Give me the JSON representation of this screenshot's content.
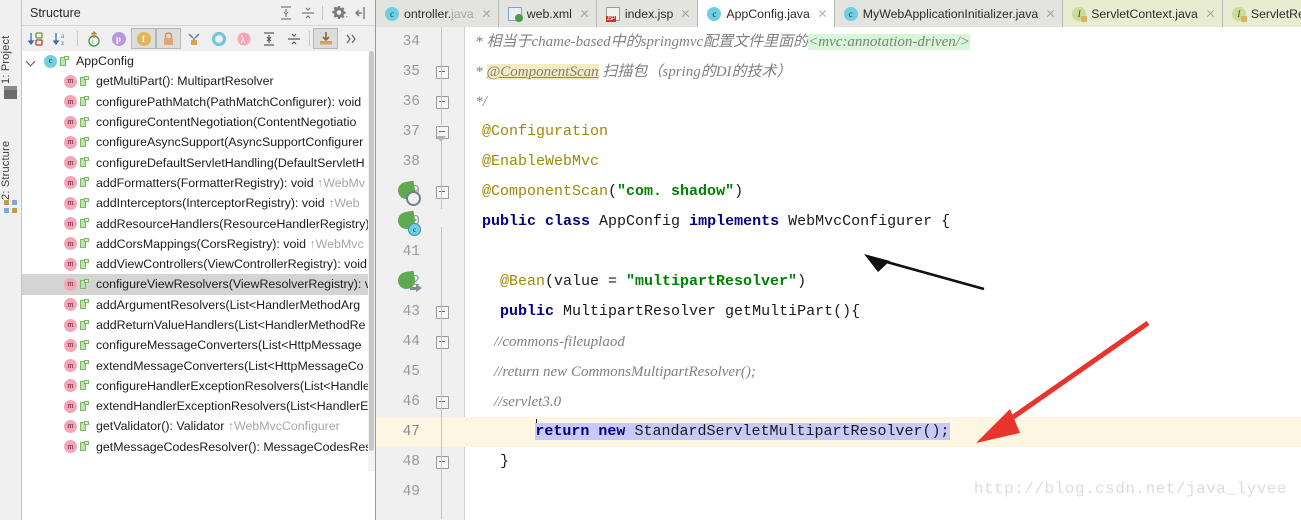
{
  "toolwindow_bar": {
    "tabs": [
      {
        "label": "1: Project",
        "icon": "project-icon"
      },
      {
        "label": "2: Structure",
        "icon": "structure-icon"
      }
    ]
  },
  "structure": {
    "title": "Structure",
    "header_icons": [
      "expand-all-icon",
      "collapse-all-icon",
      "settings-gear-icon",
      "hide-panel-icon"
    ],
    "toolbar_icons": [
      "sort-by-visibility-icon",
      "sort-alphabetically-icon",
      "show-inherited-icon",
      "show-properties-icon",
      "show-fields-icon",
      "show-non-public-icon",
      "show-anonymous-icon",
      "show-interfaces-icon",
      "show-lambdas-icon",
      "expand-all-icon",
      "collapse-all-icon",
      "autoscroll-to-source-icon",
      "overflow-icon"
    ],
    "root": {
      "label": "AppConfig",
      "badge": "c"
    },
    "members": [
      {
        "label": "getMultiPart(): MultipartResolver",
        "sup": "",
        "badge": "m"
      },
      {
        "label": "configurePathMatch(PathMatchConfigurer): void",
        "sup": "",
        "badge": "m"
      },
      {
        "label": "configureContentNegotiation(ContentNegotiatio",
        "sup": "",
        "badge": "m"
      },
      {
        "label": "configureAsyncSupport(AsyncSupportConfigurer",
        "sup": "",
        "badge": "m"
      },
      {
        "label": "configureDefaultServletHandling(DefaultServletH",
        "sup": "",
        "badge": "m"
      },
      {
        "label": "addFormatters(FormatterRegistry): void ",
        "sup": "↑WebMv",
        "badge": "m"
      },
      {
        "label": "addInterceptors(InterceptorRegistry): void ",
        "sup": "↑Web",
        "badge": "m"
      },
      {
        "label": "addResourceHandlers(ResourceHandlerRegistry)",
        "sup": "",
        "badge": "m"
      },
      {
        "label": "addCorsMappings(CorsRegistry): void ",
        "sup": "↑WebMvc",
        "badge": "m"
      },
      {
        "label": "addViewControllers(ViewControllerRegistry): void",
        "sup": "",
        "badge": "m"
      },
      {
        "label": "configureViewResolvers(ViewResolverRegistry): v",
        "sup": "",
        "badge": "m",
        "selected": true
      },
      {
        "label": "addArgumentResolvers(List<HandlerMethodArg",
        "sup": "",
        "badge": "m"
      },
      {
        "label": "addReturnValueHandlers(List<HandlerMethodRe",
        "sup": "",
        "badge": "m"
      },
      {
        "label": "configureMessageConverters(List<HttpMessage",
        "sup": "",
        "badge": "m"
      },
      {
        "label": "extendMessageConverters(List<HttpMessageCo",
        "sup": "",
        "badge": "m"
      },
      {
        "label": "configureHandlerExceptionResolvers(List<Handle",
        "sup": "",
        "badge": "m"
      },
      {
        "label": "extendHandlerExceptionResolvers(List<HandlerE",
        "sup": "",
        "badge": "m"
      },
      {
        "label": "getValidator(): Validator ",
        "sup": "↑WebMvcConfigurer",
        "badge": "m"
      },
      {
        "label": "getMessageCodesResolver(): MessageCodesRes",
        "sup": "",
        "badge": "m"
      }
    ]
  },
  "editor": {
    "tabs": [
      {
        "label": "ontroller.java",
        "icon": "class-icon",
        "state": "clipped",
        "closable": true
      },
      {
        "label": "web.xml",
        "icon": "xml-icon",
        "state": "normal",
        "closable": true
      },
      {
        "label": "index.jsp",
        "icon": "jsp-icon",
        "state": "normal",
        "closable": true
      },
      {
        "label": "AppConfig.java",
        "icon": "class-icon",
        "state": "active",
        "closable": true
      },
      {
        "label": "MyWebApplicationInitializer.java",
        "icon": "class-icon",
        "state": "normal",
        "closable": true
      },
      {
        "label": "ServletContext.java",
        "icon": "interface-icon",
        "state": "library",
        "closable": true
      },
      {
        "label": "ServletRegi",
        "icon": "interface-icon",
        "state": "library",
        "closable": false
      }
    ],
    "watermark": "http://blog.csdn.net/java_lyvee",
    "code_lines": [
      {
        "number": "34",
        "tokens": [
          {
            "text": "   * ",
            "style": "cmt"
          },
          {
            "text": "相当于chame-based中的springmvc配置文件里面的",
            "style": "cmt"
          },
          {
            "text": "<mvc:annotation-driven/>",
            "style": "cmt hl-green"
          }
        ]
      },
      {
        "number": "35",
        "tokens": [
          {
            "text": "   * ",
            "style": "cmt"
          },
          {
            "text": "@ComponentScan",
            "style": "cmt hl-yellow underline-wave"
          },
          {
            "text": " 扫描包（spring的DI的技术）",
            "style": "cmt"
          }
        ],
        "fold": "minus"
      },
      {
        "number": "36",
        "tokens": [
          {
            "text": "   */",
            "style": "cmt"
          }
        ],
        "fold": "minus"
      },
      {
        "number": "37",
        "tokens": [
          {
            "text": "  @Configuration",
            "style": "anno"
          }
        ],
        "fold": "arrow"
      },
      {
        "number": "38",
        "tokens": [
          {
            "text": "  @EnableWebMvc",
            "style": "anno"
          }
        ]
      },
      {
        "number": "39",
        "tokens": [
          {
            "text": "  @ComponentScan",
            "style": "anno"
          },
          {
            "text": "(",
            "style": ""
          },
          {
            "text": "\"com. shadow\"",
            "style": "str"
          },
          {
            "text": ")",
            "style": ""
          }
        ],
        "gutter_icon": "spring-config-search-icon",
        "fold": "minus"
      },
      {
        "number": "40",
        "tokens": [
          {
            "text": "  ",
            "style": ""
          },
          {
            "text": "public class",
            "style": "kw"
          },
          {
            "text": " AppConfig ",
            "style": ""
          },
          {
            "text": "implements",
            "style": "kw"
          },
          {
            "text": " WebMvcConfigurer {",
            "style": ""
          }
        ],
        "gutter_icon": "spring-bean-class-icon"
      },
      {
        "number": "41",
        "tokens": [
          {
            "text": "",
            "style": ""
          }
        ]
      },
      {
        "number": "42",
        "tokens": [
          {
            "text": "    @Bean",
            "style": "anno"
          },
          {
            "text": "(value = ",
            "style": ""
          },
          {
            "text": "\"multipartResolver\"",
            "style": "str"
          },
          {
            "text": ")",
            "style": ""
          }
        ],
        "gutter_icon": "spring-bean-navigate-icon"
      },
      {
        "number": "43",
        "tokens": [
          {
            "text": "    ",
            "style": ""
          },
          {
            "text": "public",
            "style": "kw"
          },
          {
            "text": " MultipartResolver getMultiPart(){",
            "style": ""
          }
        ],
        "fold": "minus"
      },
      {
        "number": "44",
        "tokens": [
          {
            "text": "        //commons-fileuplaod",
            "style": "cmt"
          }
        ],
        "fold": "minus"
      },
      {
        "number": "45",
        "tokens": [
          {
            "text": "        //return new CommonsMultipartResolver();",
            "style": "cmt"
          }
        ]
      },
      {
        "number": "46",
        "tokens": [
          {
            "text": "        //servlet3.0",
            "style": "cmt"
          }
        ],
        "fold": "minus"
      },
      {
        "number": "47",
        "current": true,
        "caret": true,
        "tokens": [
          {
            "text": "        ",
            "style": ""
          },
          {
            "text": "return new",
            "style": "kw sel-text"
          },
          {
            "text": " StandardServletMultipartResolver();",
            "style": "sel-text"
          }
        ]
      },
      {
        "number": "48",
        "tokens": [
          {
            "text": "    }",
            "style": ""
          }
        ],
        "fold": "minus"
      },
      {
        "number": "49",
        "tokens": [
          {
            "text": "",
            "style": ""
          }
        ]
      }
    ]
  },
  "annotations": {
    "black_arrow": {
      "label": "black-pointer-arrow",
      "color": "#111111"
    },
    "red_arrow": {
      "label": "red-pointer-arrow",
      "color": "#e8342a"
    }
  },
  "colors": {
    "keyword": "#000080",
    "annotation": "#9e880d",
    "string": "#008000",
    "comment": "#808080",
    "selection": "#c9c9f7",
    "current_line": "#fdf6e3",
    "tree_selection": "#d4d4d4"
  }
}
